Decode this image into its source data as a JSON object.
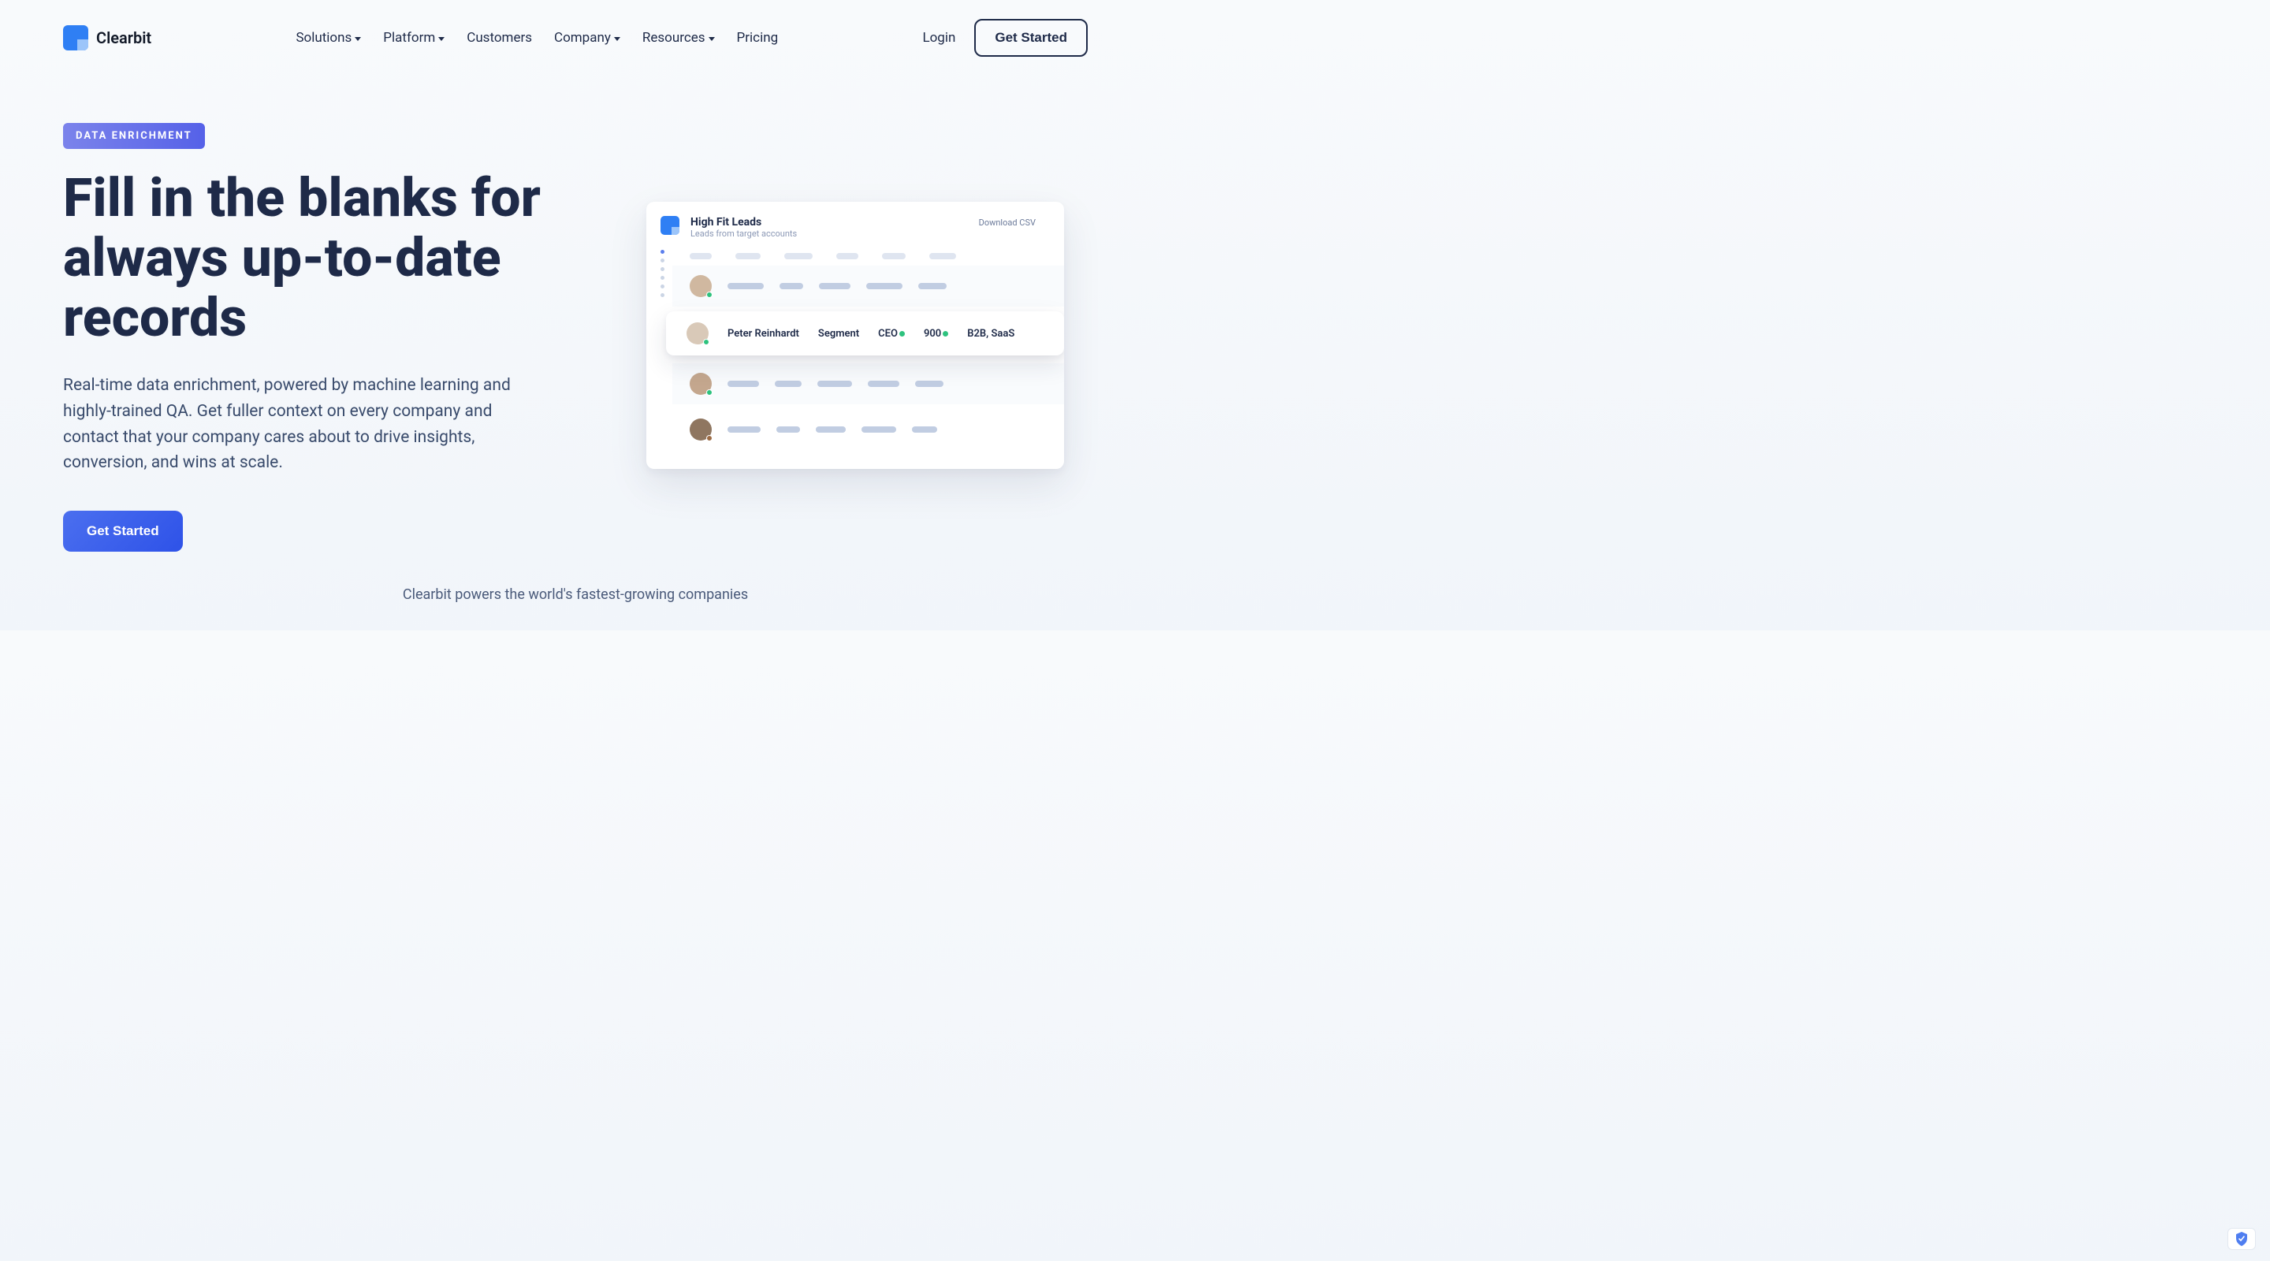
{
  "brand": "Clearbit",
  "nav": {
    "items": [
      {
        "label": "Solutions",
        "dropdown": true
      },
      {
        "label": "Platform",
        "dropdown": true
      },
      {
        "label": "Customers",
        "dropdown": false
      },
      {
        "label": "Company",
        "dropdown": true
      },
      {
        "label": "Resources",
        "dropdown": true
      },
      {
        "label": "Pricing",
        "dropdown": false
      }
    ],
    "login": "Login",
    "cta": "Get Started"
  },
  "hero": {
    "badge": "DATA ENRICHMENT",
    "title": "Fill in the blanks for always up-to-date records",
    "description": "Real-time data enrichment, powered by machine learning and highly-trained QA. Get fuller context on every company and contact that your company cares about to drive insights, conversion, and wins at scale.",
    "cta": "Get Started"
  },
  "mock": {
    "title": "High Fit Leads",
    "subtitle": "Leads from target accounts",
    "download": "Download CSV",
    "highlight": {
      "name": "Peter Reinhardt",
      "company": "Segment",
      "role": "CEO",
      "count": "900",
      "tags": "B2B, SaaS"
    }
  },
  "footer_tag": "Clearbit powers the world's fastest-growing companies"
}
